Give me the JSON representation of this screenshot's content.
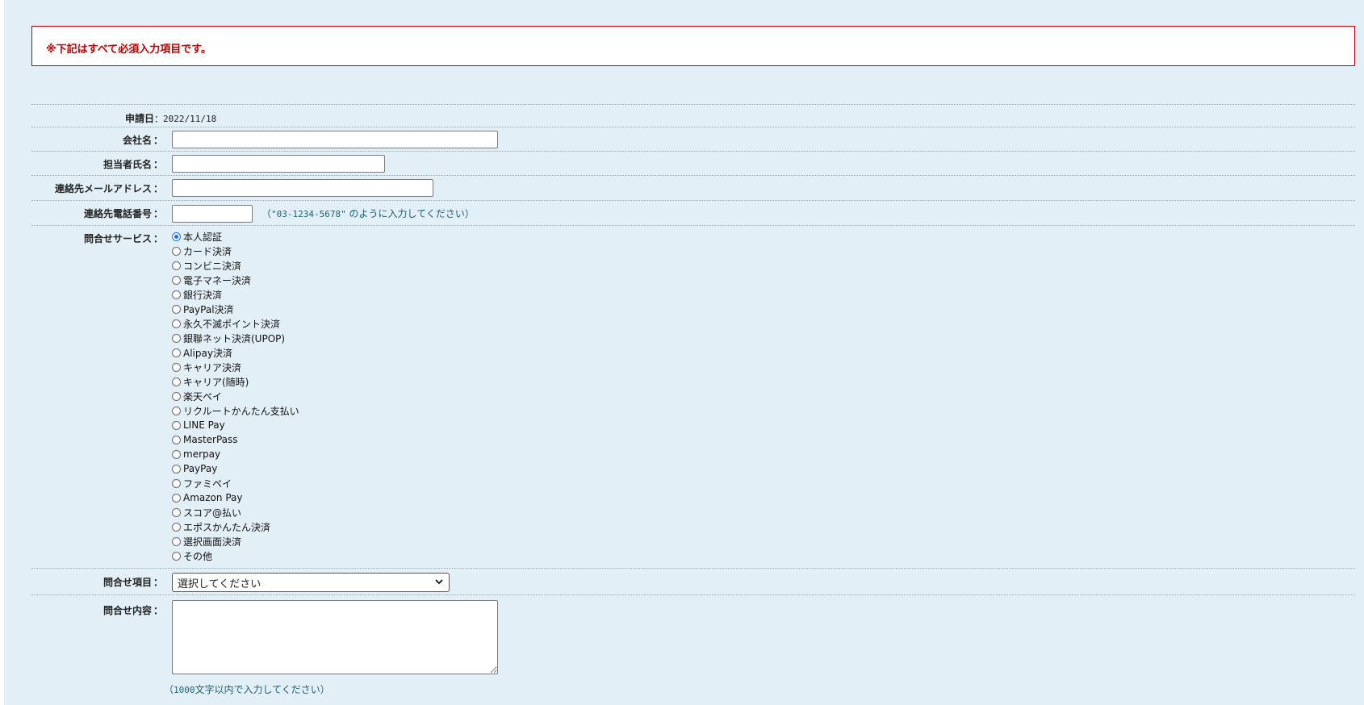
{
  "notice": {
    "text": "※下記はすべて必須入力項目です。"
  },
  "form": {
    "date": {
      "label": "申請日",
      "value": "2022/11/18"
    },
    "company": {
      "label": "会社名",
      "value": ""
    },
    "person": {
      "label": "担当者氏名",
      "value": ""
    },
    "email": {
      "label": "連絡先メールアドレス",
      "value": ""
    },
    "phone": {
      "label": "連絡先電話番号",
      "value": "",
      "hint_open": "（",
      "hint_example": "\"03-1234-5678\"",
      "hint_rest": " のように入力してください）"
    },
    "service": {
      "label": "問合せサービス",
      "selected_index": 0,
      "options": [
        "本人認証",
        "カード決済",
        "コンビニ決済",
        "電子マネー決済",
        "銀行決済",
        "PayPal決済",
        "永久不滅ポイント決済",
        "銀聯ネット決済(UPOP)",
        "Alipay決済",
        "キャリア決済",
        "キャリア(随時)",
        "楽天ペイ",
        "リクルートかんたん支払い",
        "LINE Pay",
        "MasterPass",
        "merpay",
        "PayPay",
        "ファミペイ",
        "Amazon Pay",
        "スコア@払い",
        "エポスかんたん決済",
        "選択画面決済",
        "その他"
      ]
    },
    "category": {
      "label": "問合せ項目",
      "selected": "選択してください"
    },
    "content": {
      "label": "問合せ内容",
      "value": "",
      "hint_open": "（",
      "hint_number": "1000",
      "hint_rest": "文字以内で入力してください）"
    },
    "colon": "："
  },
  "colors": {
    "notice_red": "#c00000",
    "page_bg": "#e2eff6",
    "hint_teal": "#1f5f73",
    "radio_blue": "#1a73e8"
  }
}
